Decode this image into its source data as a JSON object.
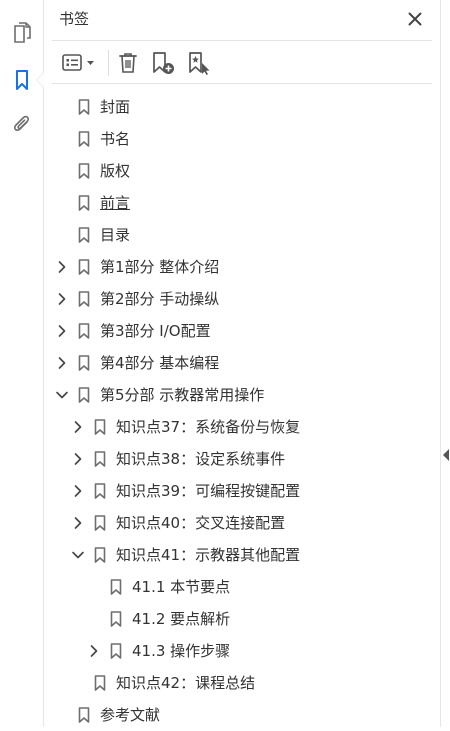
{
  "panel": {
    "title": "书签"
  },
  "colors": {
    "accent": "#1473e6",
    "icon": "#6e6e6e",
    "text": "#333333"
  },
  "rail": {
    "icons": [
      "pages-icon",
      "bookmark-icon",
      "attachment-icon"
    ]
  },
  "toolbar": {
    "icons": [
      "options-menu-icon",
      "delete-icon",
      "new-bookmark-icon",
      "bookmark-from-selection-icon"
    ]
  },
  "bookmarks": [
    {
      "label": "封面",
      "level": 0,
      "chevron": "none"
    },
    {
      "label": "书名",
      "level": 0,
      "chevron": "none"
    },
    {
      "label": "版权",
      "level": 0,
      "chevron": "none"
    },
    {
      "label": "前言",
      "level": 0,
      "chevron": "none",
      "underline": true
    },
    {
      "label": "目录",
      "level": 0,
      "chevron": "none"
    },
    {
      "label": "第1部分  整体介绍",
      "level": 0,
      "chevron": "collapsed"
    },
    {
      "label": "第2部分  手动操纵",
      "level": 0,
      "chevron": "collapsed"
    },
    {
      "label": "第3部分  I/O配置",
      "level": 0,
      "chevron": "collapsed"
    },
    {
      "label": "第4部分  基本编程",
      "level": 0,
      "chevron": "collapsed"
    },
    {
      "label": "第5分部  示教器常用操作",
      "level": 0,
      "chevron": "expanded"
    },
    {
      "label": "知识点37：系统备份与恢复",
      "level": 1,
      "chevron": "collapsed"
    },
    {
      "label": "知识点38：设定系统事件",
      "level": 1,
      "chevron": "collapsed"
    },
    {
      "label": "知识点39：可编程按键配置",
      "level": 1,
      "chevron": "collapsed"
    },
    {
      "label": "知识点40：交叉连接配置",
      "level": 1,
      "chevron": "collapsed"
    },
    {
      "label": "知识点41：示教器其他配置",
      "level": 1,
      "chevron": "expanded"
    },
    {
      "label": "41.1  本节要点",
      "level": 2,
      "chevron": "none"
    },
    {
      "label": "41.2  要点解析",
      "level": 2,
      "chevron": "none"
    },
    {
      "label": "41.3  操作步骤",
      "level": 2,
      "chevron": "collapsed"
    },
    {
      "label": "知识点42：课程总结",
      "level": 1,
      "chevron": "none"
    },
    {
      "label": "参考文献",
      "level": 0,
      "chevron": "none"
    }
  ]
}
